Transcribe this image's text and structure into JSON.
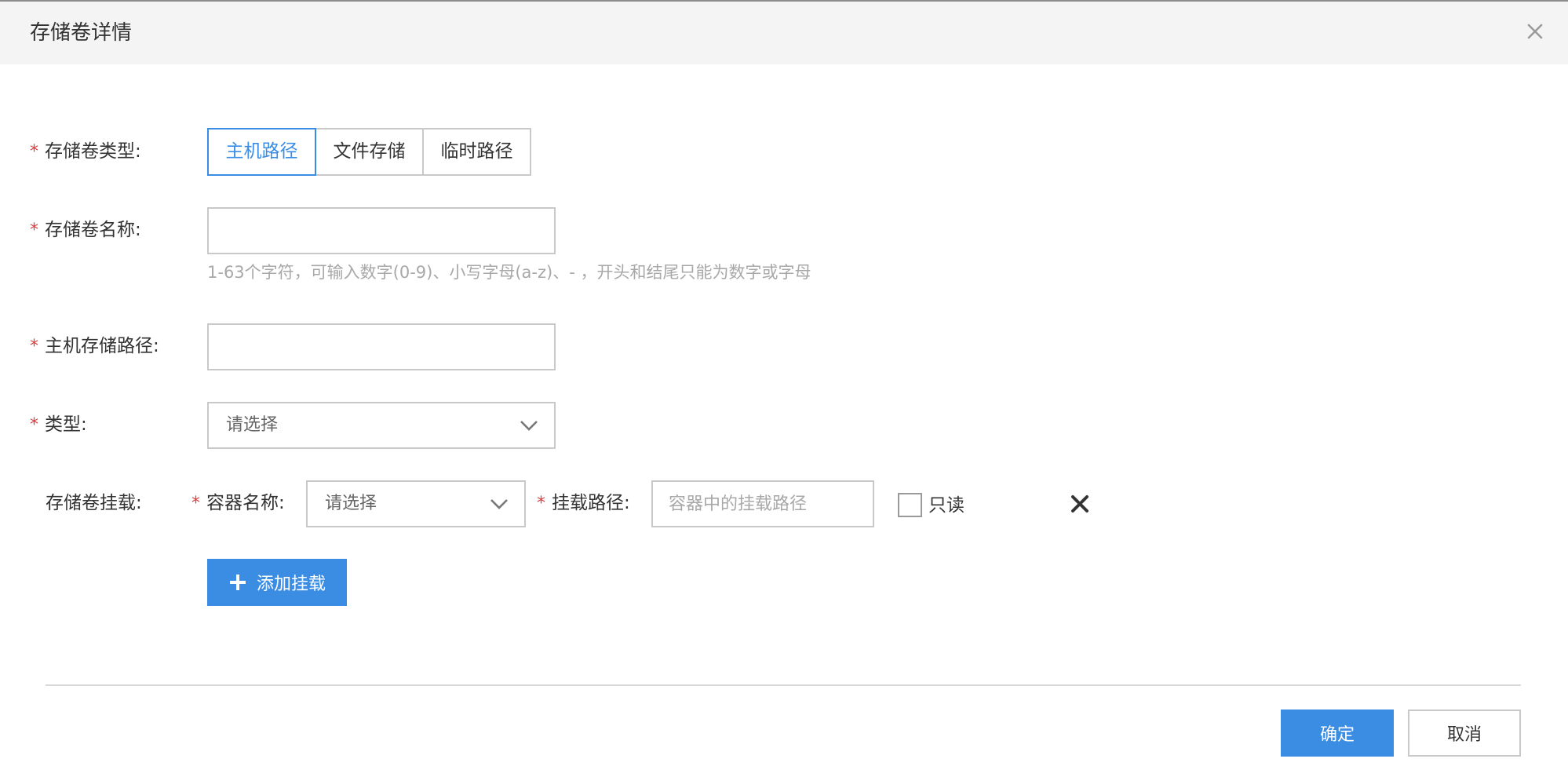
{
  "dialog": {
    "title": "存储卷详情"
  },
  "form": {
    "volume_type": {
      "label": "存储卷类型:",
      "options": [
        "主机路径",
        "文件存储",
        "临时路径"
      ],
      "selected": "主机路径"
    },
    "volume_name": {
      "label": "存储卷名称:",
      "value": "",
      "hint": "1-63个字符，可输入数字(0-9)、小写字母(a-z)、- ，开头和结尾只能为数字或字母"
    },
    "host_path": {
      "label": "主机存储路径:",
      "value": ""
    },
    "type": {
      "label": "类型:",
      "placeholder": "请选择"
    },
    "mount": {
      "label": "存储卷挂载:",
      "container_label": "容器名称:",
      "container_placeholder": "请选择",
      "path_label": "挂载路径:",
      "path_placeholder": "容器中的挂载路径",
      "readonly_label": "只读",
      "readonly_checked": false,
      "add_label": "添加挂载"
    }
  },
  "footer": {
    "ok_label": "确定",
    "cancel_label": "取消"
  },
  "colors": {
    "primary": "#3b8de4",
    "required": "#e03c3c",
    "header_bg": "#f4f4f4",
    "hint": "#a8a8a8"
  },
  "icons": {
    "close": "close-icon",
    "chevron": "chevron-down-icon",
    "remove": "remove-icon",
    "add": "plus-icon"
  }
}
